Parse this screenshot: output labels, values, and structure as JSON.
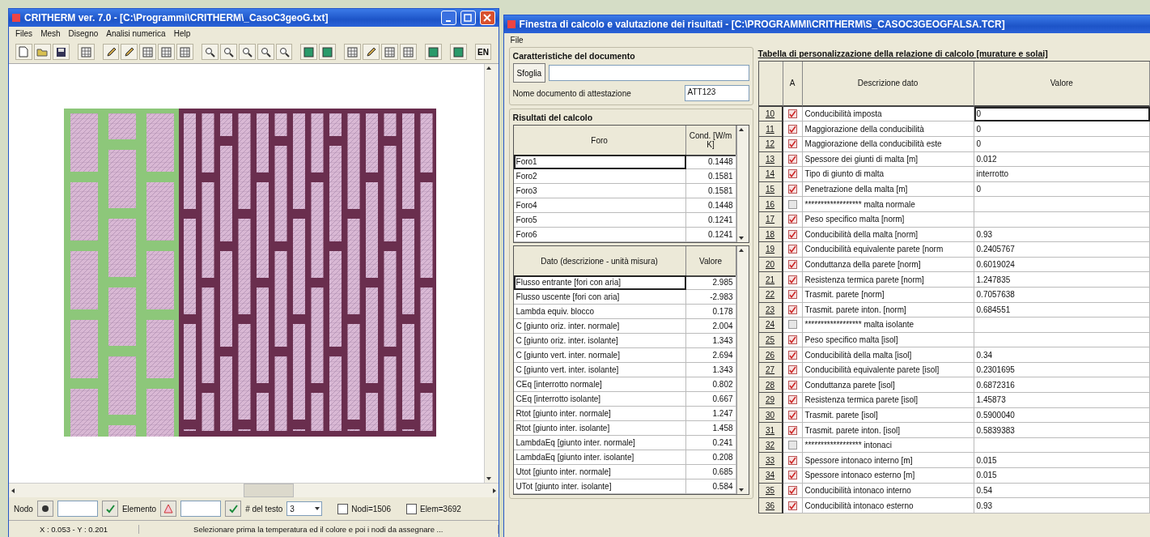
{
  "left_window": {
    "title": "CRITHERM ver. 7.0 - [C:\\Programmi\\CRITHERM\\_CasoC3geoG.txt]",
    "menu": [
      "Files",
      "Mesh",
      "Disegno",
      "Analisi numerica",
      "Help"
    ],
    "toolbar_text_button": "EN",
    "bottom_bar": {
      "node_label": "Nodo",
      "element_label": "Elemento",
      "text_size_label": "# del testo",
      "text_size_value": "3",
      "checkboxes": [
        {
          "label": "Nodi=1506",
          "checked": false
        },
        {
          "label": "Elem=3692",
          "checked": false
        }
      ]
    },
    "status_bar": {
      "coordinates": "X : 0.053 - Y : 0.201",
      "message": "Selezionare prima la temperatura ed il colore e poi i nodi da assegnare ..."
    }
  },
  "right_window": {
    "title": "Finestra di calcolo e valutazione dei risultati - [C:\\PROGRAMMI\\CRITHERM\\S_CASOC3GEOGFALSA.TCR]",
    "menu": [
      "File"
    ],
    "document_group": {
      "title": "Caratteristiche del documento",
      "browse_button": "Sfoglia",
      "name_label": "Nome documento di attestazione",
      "name_value": "ATT123"
    },
    "results_group": {
      "title": "Risultati del calcolo",
      "holes_table": {
        "columns": [
          "Foro",
          "Cond. [W/m K]"
        ],
        "rows": [
          {
            "name": "Foro1",
            "value": "0.1448",
            "selected": true
          },
          {
            "name": "Foro2",
            "value": "0.1581",
            "selected": false
          },
          {
            "name": "Foro3",
            "value": "0.1581",
            "selected": false
          },
          {
            "name": "Foro4",
            "value": "0.1448",
            "selected": false
          },
          {
            "name": "Foro5",
            "value": "0.1241",
            "selected": false
          },
          {
            "name": "Foro6",
            "value": "0.1241",
            "selected": false
          }
        ]
      },
      "data_table": {
        "columns": [
          "Dato (descrizione - unità misura)",
          "Valore"
        ],
        "rows": [
          {
            "name": "Flusso entrante [fori con aria]",
            "value": "2.985",
            "selected": true
          },
          {
            "name": "Flusso uscente [fori con aria]",
            "value": "-2.983",
            "selected": false
          },
          {
            "name": "Lambda equiv. blocco",
            "value": "0.178",
            "selected": false
          },
          {
            "name": "C [giunto oriz. inter. normale]",
            "value": "2.004",
            "selected": false
          },
          {
            "name": "C [giunto oriz. inter. isolante]",
            "value": "1.343",
            "selected": false
          },
          {
            "name": "C [giunto vert. inter. normale]",
            "value": "2.694",
            "selected": false
          },
          {
            "name": "C [giunto vert. inter. isolante]",
            "value": "1.343",
            "selected": false
          },
          {
            "name": "CEq [interrotto normale]",
            "value": "0.802",
            "selected": false
          },
          {
            "name": "CEq [interrotto isolante]",
            "value": "0.667",
            "selected": false
          },
          {
            "name": "Rtot [giunto inter. normale]",
            "value": "1.247",
            "selected": false
          },
          {
            "name": "Rtot [giunto inter. isolante]",
            "value": "1.458",
            "selected": false
          },
          {
            "name": "LambdaEq [giunto inter. normale]",
            "value": "0.241",
            "selected": false
          },
          {
            "name": "LambdaEq [giunto inter. isolante]",
            "value": "0.208",
            "selected": false
          },
          {
            "name": "Utot [giunto inter. normale]",
            "value": "0.685",
            "selected": false
          },
          {
            "name": "UTot [giunto inter. isolante]",
            "value": "0.584",
            "selected": false
          }
        ]
      }
    },
    "report_table": {
      "title": "Tabella di personalizzazione della relazione di calcolo [murature e solai]",
      "columns": [
        "A",
        "Descrizione dato",
        "Valore"
      ],
      "rows": [
        {
          "number": "10",
          "kind": "item",
          "description": "Conducibilità imposta",
          "value": "0",
          "selected": true
        },
        {
          "number": "11",
          "kind": "item",
          "description": "Maggiorazione della conducibilità",
          "value": "0",
          "selected": false
        },
        {
          "number": "12",
          "kind": "item",
          "description": "Maggiorazione della conducibilità este",
          "value": "0",
          "selected": false
        },
        {
          "number": "13",
          "kind": "item",
          "description": "Spessore dei giunti di malta [m]",
          "value": "0.012",
          "selected": false
        },
        {
          "number": "14",
          "kind": "item",
          "description": "Tipo di giunto di malta",
          "value": "interrotto",
          "selected": false
        },
        {
          "number": "15",
          "kind": "item",
          "description": "Penetrazione della malta [m]",
          "value": "0",
          "selected": false
        },
        {
          "number": "16",
          "kind": "section",
          "description": "****************** malta normale",
          "selected": false
        },
        {
          "number": "17",
          "kind": "item",
          "description": "Peso specifico malta [norm]",
          "selected": false
        },
        {
          "number": "18",
          "kind": "item",
          "description": "Conducibilità della malta [norm]",
          "value": "0.93",
          "selected": false
        },
        {
          "number": "19",
          "kind": "item",
          "description": "Conducibilità equivalente parete [norm",
          "value": "0.2405767",
          "selected": false
        },
        {
          "number": "20",
          "kind": "item",
          "description": "Conduttanza della parete [norm]",
          "value": "0.6019024",
          "selected": false
        },
        {
          "number": "21",
          "kind": "item",
          "description": "Resistenza termica parete [norm]",
          "value": "1.247835",
          "selected": false
        },
        {
          "number": "22",
          "kind": "item",
          "description": "Trasmit. parete [norm]",
          "value": "0.7057638",
          "selected": false
        },
        {
          "number": "23",
          "kind": "item",
          "description": "Trasmit. parete inton. [norm]",
          "value": "0.684551",
          "selected": false
        },
        {
          "number": "24",
          "kind": "section",
          "description": "****************** malta isolante",
          "selected": false
        },
        {
          "number": "25",
          "kind": "item",
          "description": "Peso specifico malta [isol]",
          "selected": false
        },
        {
          "number": "26",
          "kind": "item",
          "description": "Conducibilità della malta [isol]",
          "value": "0.34",
          "selected": false
        },
        {
          "number": "27",
          "kind": "item",
          "description": "Conducibilità equivalente parete [isol]",
          "value": "0.2301695",
          "selected": false
        },
        {
          "number": "28",
          "kind": "item",
          "description": "Conduttanza parete [isol]",
          "value": "0.6872316",
          "selected": false
        },
        {
          "number": "29",
          "kind": "item",
          "description": "Resistenza termica parete [isol]",
          "value": "1.45873",
          "selected": false
        },
        {
          "number": "30",
          "kind": "item",
          "description": "Trasmit. parete [isol]",
          "value": "0.5900040",
          "selected": false
        },
        {
          "number": "31",
          "kind": "item",
          "description": "Trasmit. parete inton. [isol]",
          "value": "0.5839383",
          "selected": false
        },
        {
          "number": "32",
          "kind": "section",
          "description": "****************** intonaci",
          "selected": false
        },
        {
          "number": "33",
          "kind": "item",
          "description": "Spessore intonaco interno [m]",
          "value": "0.015",
          "selected": false
        },
        {
          "number": "34",
          "kind": "item",
          "description": "Spessore intonaco esterno [m]",
          "value": "0.015",
          "selected": false
        },
        {
          "number": "35",
          "kind": "item",
          "description": "Conducibilità intonaco interno",
          "value": "0.54",
          "selected": false
        },
        {
          "number": "36",
          "kind": "item",
          "description": "Conducibilità intonaco esterno",
          "value": "0.93",
          "selected": false
        }
      ]
    }
  }
}
